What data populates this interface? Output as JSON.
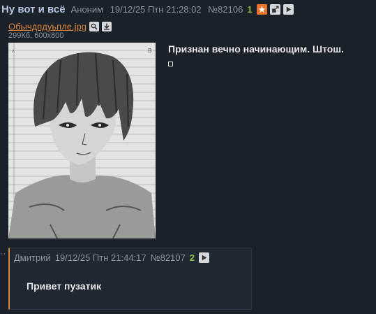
{
  "op": {
    "subject": "Ну вот и всё",
    "author": "Аноним",
    "datetime": "19/12/25 Птн 21:28:02",
    "post_number": "№82106",
    "reply_count": "1",
    "file": {
      "name": "Обычдпдуьпле.jpg",
      "info": "299Кб, 600x800"
    },
    "text": "Признан вечно начинающим. Штош.",
    "icons": [
      "star-icon",
      "expand-icon",
      "play-icon",
      "search-icon",
      "download-icon"
    ]
  },
  "reply": {
    "marker": "··",
    "author": "Дмитрий",
    "datetime": "19/12/25 Птн 21:44:17",
    "post_number": "№82107",
    "reply_count": "2",
    "text": "Привет пузатик"
  },
  "colors": {
    "background": "#1a2129",
    "subject": "#b3c6e0",
    "accent": "#d9843b",
    "count": "#8fbf3f"
  }
}
